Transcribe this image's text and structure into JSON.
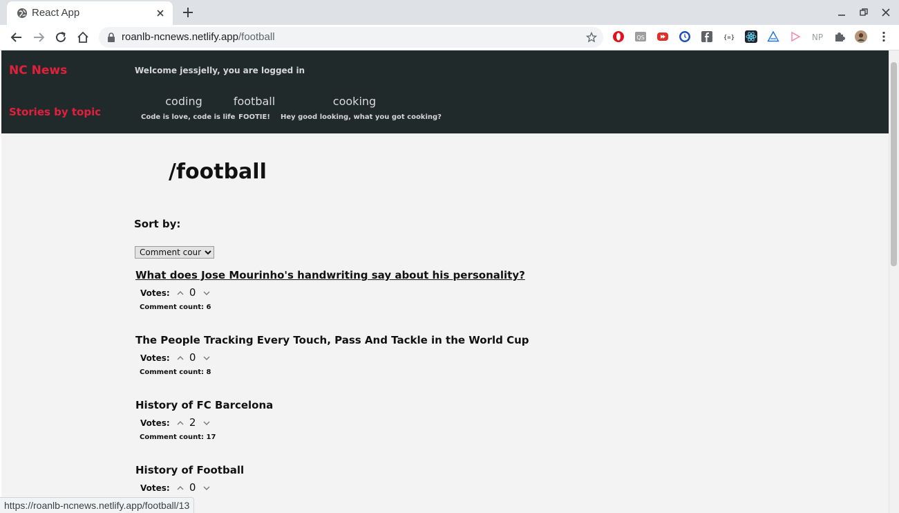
{
  "browser": {
    "tab_title": "React App",
    "url_host": "roanlb-ncnews.netlify.app",
    "url_path": "/football",
    "status_url": "https://roanlb-ncnews.netlify.app/football/13"
  },
  "header": {
    "brand": "NC News",
    "stories_label": "Stories by topic",
    "welcome": "Welcome jessjelly, you are logged in",
    "topics": [
      {
        "name": "coding",
        "description": "Code is love, code is life"
      },
      {
        "name": "football",
        "description": "FOOTIE!"
      },
      {
        "name": "cooking",
        "description": "Hey good looking, what you got cooking?"
      }
    ]
  },
  "main": {
    "page_title": "/football",
    "sort_label": "Sort by:",
    "sort_selected": "Comment count",
    "votes_label": "Votes:",
    "articles": [
      {
        "title": "What does Jose Mourinho's handwriting say about his personality?",
        "votes": "0",
        "comment_count": "Comment count: 6"
      },
      {
        "title": "The People Tracking Every Touch, Pass And Tackle in the World Cup",
        "votes": "0",
        "comment_count": "Comment count: 8"
      },
      {
        "title": "History of FC Barcelona",
        "votes": "2",
        "comment_count": "Comment count: 17"
      },
      {
        "title": "History of Football",
        "votes": "0",
        "comment_count": ""
      }
    ]
  },
  "colors": {
    "header_bg": "#212a2b",
    "brand_red": "#e2203c",
    "content_bg": "#f3f3f3"
  }
}
